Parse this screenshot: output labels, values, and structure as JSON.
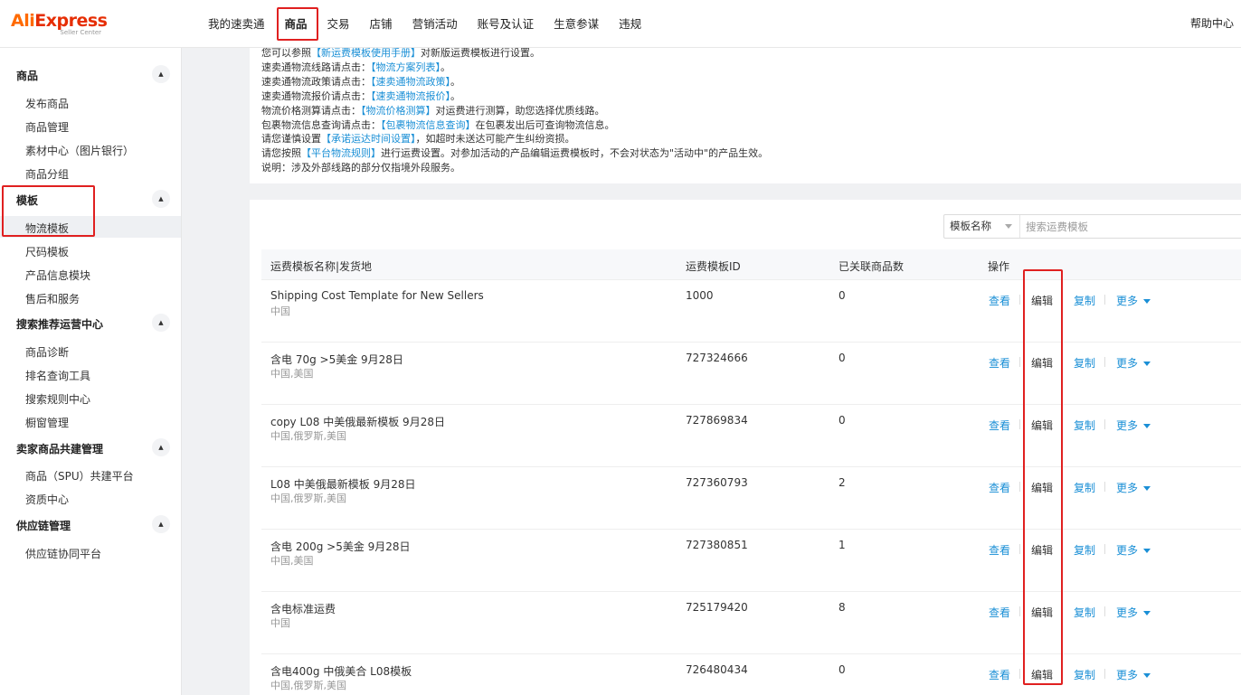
{
  "logo": {
    "main_a": "Ali",
    "main_b": "Express",
    "sub": "Seller Center"
  },
  "nav": {
    "items": [
      "我的速卖通",
      "商品",
      "交易",
      "店铺",
      "营销活动",
      "账号及认证",
      "生意参谋",
      "违规"
    ],
    "active": "商品",
    "help": "帮助中心"
  },
  "sidebar": {
    "groups": [
      {
        "title": "商品",
        "items": [
          "发布商品",
          "商品管理",
          "素材中心（图片银行）",
          "商品分组"
        ]
      },
      {
        "title": "模板",
        "items": [
          "物流模板",
          "尺码模板",
          "产品信息模块",
          "售后和服务"
        ]
      },
      {
        "title": "搜索推荐运营中心",
        "items": [
          "商品诊断",
          "排名查询工具",
          "搜索规则中心",
          "橱窗管理"
        ]
      },
      {
        "title": "卖家商品共建管理",
        "items": [
          "商品（SPU）共建平台",
          "资质中心"
        ]
      },
      {
        "title": "供应链管理",
        "items": [
          "供应链协同平台"
        ]
      }
    ],
    "active_item": "物流模板",
    "collapse_glyph": "▲"
  },
  "notice": {
    "lines": [
      {
        "pre": "您可以参照",
        "link": "【新运费模板使用手册】",
        "post": "对新版运费模板进行设置。"
      },
      {
        "pre": "速卖通物流线路请点击：",
        "link": "【物流方案列表】",
        "post": "。"
      },
      {
        "pre": "速卖通物流政策请点击：",
        "link": "【速卖通物流政策】",
        "post": "。"
      },
      {
        "pre": "速卖通物流报价请点击：",
        "link": "【速卖通物流报价】",
        "post": "。"
      },
      {
        "pre": "物流价格测算请点击：",
        "link": "【物流价格测算】",
        "post": "对运费进行测算，助您选择优质线路。"
      },
      {
        "pre": "包裹物流信息查询请点击：",
        "link": "【包裹物流信息查询】",
        "post": "在包裹发出后可查询物流信息。"
      },
      {
        "pre": "请您谨慎设置",
        "link": "【承诺运达时间设置】",
        "post": "，如超时未送达可能产生纠纷资损。"
      },
      {
        "pre": "请您按照",
        "link": "【平台物流规则】",
        "post": "进行运费设置。对参加活动的产品编辑运费模板时，不会对状态为\"活动中\"的产品生效。"
      },
      {
        "pre": "说明：涉及外部线路的部分仅指境外段服务。",
        "link": "",
        "post": ""
      }
    ]
  },
  "filter": {
    "select_value": "模板名称",
    "placeholder": "搜索运费模板"
  },
  "table": {
    "headers": {
      "name": "运费模板名称|发货地",
      "id": "运费模板ID",
      "count": "已关联商品数",
      "ops": "操作"
    },
    "actions": {
      "view": "查看",
      "edit": "编辑",
      "copy": "复制",
      "more": "更多"
    },
    "rows": [
      {
        "name": "Shipping Cost Template for New Sellers",
        "region": "中国",
        "id": "1000",
        "count": "0"
      },
      {
        "name": "含电 70g  >5美金 9月28日",
        "region": "中国,美国",
        "id": "727324666",
        "count": "0"
      },
      {
        "name": "copy L08 中美俄最新模板 9月28日",
        "region": "中国,俄罗斯,美国",
        "id": "727869834",
        "count": "0"
      },
      {
        "name": "L08 中美俄最新模板 9月28日",
        "region": "中国,俄罗斯,美国",
        "id": "727360793",
        "count": "2"
      },
      {
        "name": "含电 200g  >5美金 9月28日",
        "region": "中国,美国",
        "id": "727380851",
        "count": "1"
      },
      {
        "name": "含电标准运费",
        "region": "中国",
        "id": "725179420",
        "count": "8"
      },
      {
        "name": "含电400g  中俄美合 L08模板",
        "region": "中国,俄罗斯,美国",
        "id": "726480434",
        "count": "0"
      }
    ]
  },
  "colors": {
    "link": "#1a8fd6",
    "highlight": "#e02020",
    "brand": "#e62e04"
  }
}
